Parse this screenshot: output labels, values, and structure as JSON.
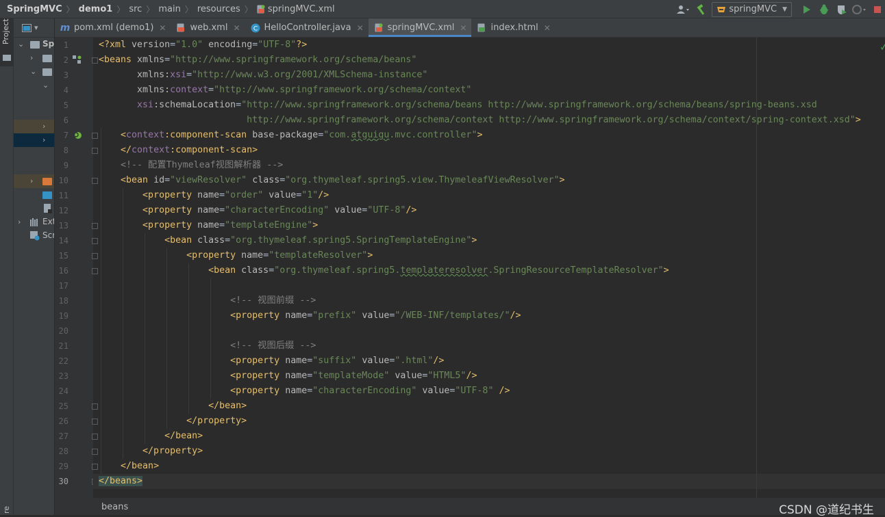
{
  "breadcrumb": {
    "items": [
      "SpringMVC",
      "demo1",
      "src",
      "main",
      "resources",
      "springMVC.xml"
    ]
  },
  "toolbar": {
    "run_config": "springMVC",
    "icons": [
      "user-icon",
      "hammer-icon",
      "run-icon",
      "debug-icon",
      "coverage-icon",
      "profile-icon",
      "stop-icon"
    ]
  },
  "sidebar": {
    "stripe_label": "Project",
    "bottom_label": "re",
    "root_label": "Sp",
    "ext_label": "Ext",
    "scr_label": "Scr"
  },
  "tabs": [
    {
      "label": "pom.xml (demo1)",
      "icon": "maven-icon",
      "active": false
    },
    {
      "label": "web.xml",
      "icon": "xml-file-icon",
      "active": false
    },
    {
      "label": "HelloController.java",
      "icon": "java-class-icon",
      "active": false
    },
    {
      "label": "springMVC.xml",
      "icon": "spring-xml-icon",
      "active": true
    },
    {
      "label": "index.html",
      "icon": "html-file-icon",
      "active": false
    }
  ],
  "editor": {
    "current_line": 30,
    "line_numbers": [
      "1",
      "2",
      "3",
      "4",
      "5",
      "6",
      "7",
      "8",
      "9",
      "10",
      "11",
      "12",
      "13",
      "14",
      "15",
      "16",
      "17",
      "18",
      "19",
      "20",
      "21",
      "22",
      "23",
      "24",
      "25",
      "26",
      "27",
      "28",
      "29",
      "30"
    ],
    "lines": [
      {
        "indent": "",
        "parts": [
          [
            "t",
            "<?xml "
          ],
          [
            "a",
            "version"
          ],
          [
            "p",
            "="
          ],
          [
            "v",
            "\"1.0\" "
          ],
          [
            "a",
            "encoding"
          ],
          [
            "p",
            "="
          ],
          [
            "v",
            "\"UTF-8\""
          ],
          [
            "t",
            "?>"
          ]
        ]
      },
      {
        "indent": "",
        "parts": [
          [
            "t",
            "<beans "
          ],
          [
            "a",
            "xmlns"
          ],
          [
            "p",
            "="
          ],
          [
            "v",
            "\"http://www.springframework.org/schema/beans\""
          ]
        ]
      },
      {
        "indent": "       ",
        "parts": [
          [
            "a",
            "xmlns:"
          ],
          [
            "ns",
            "xsi"
          ],
          [
            "p",
            "="
          ],
          [
            "v",
            "\"http://www.w3.org/2001/XMLSchema-instance\""
          ]
        ]
      },
      {
        "indent": "       ",
        "parts": [
          [
            "a",
            "xmlns:"
          ],
          [
            "ns",
            "context"
          ],
          [
            "p",
            "="
          ],
          [
            "v",
            "\"http://www.springframework.org/schema/context\""
          ]
        ]
      },
      {
        "indent": "       ",
        "parts": [
          [
            "ns",
            "xsi"
          ],
          [
            "a",
            ":schemaLocation"
          ],
          [
            "p",
            "="
          ],
          [
            "v",
            "\"http://www.springframework.org/schema/beans http://www.springframework.org/schema/beans/spring-beans.xsd"
          ]
        ]
      },
      {
        "indent": "                           ",
        "parts": [
          [
            "v",
            "http://www.springframework.org/schema/context http://www.springframework.org/schema/context/spring-context.xsd\""
          ],
          [
            "t",
            ">"
          ]
        ]
      },
      {
        "indent": "    ",
        "parts": [
          [
            "t",
            "<"
          ],
          [
            "ns",
            "context"
          ],
          [
            "t",
            ":component-scan "
          ],
          [
            "a",
            "base-package"
          ],
          [
            "p",
            "="
          ],
          [
            "v",
            "\"com."
          ],
          [
            "vs",
            "atguigu"
          ],
          [
            "v",
            ".mvc.controller\""
          ],
          [
            "t",
            ">"
          ]
        ]
      },
      {
        "indent": "    ",
        "parts": [
          [
            "t",
            "</"
          ],
          [
            "ns",
            "context"
          ],
          [
            "t",
            ":component-scan>"
          ]
        ]
      },
      {
        "indent": "    ",
        "parts": [
          [
            "c",
            "<!-- 配置Thymeleaf视图解析器 -->"
          ]
        ]
      },
      {
        "indent": "    ",
        "parts": [
          [
            "t",
            "<bean "
          ],
          [
            "a",
            "id"
          ],
          [
            "p",
            "="
          ],
          [
            "v",
            "\"viewResolver\" "
          ],
          [
            "a",
            "class"
          ],
          [
            "p",
            "="
          ],
          [
            "v",
            "\"org.thymeleaf.spring5.view.ThymeleafViewResolver\""
          ],
          [
            "t",
            ">"
          ]
        ]
      },
      {
        "indent": "        ",
        "parts": [
          [
            "t",
            "<property "
          ],
          [
            "a",
            "name"
          ],
          [
            "p",
            "="
          ],
          [
            "v",
            "\"order\" "
          ],
          [
            "a",
            "value"
          ],
          [
            "p",
            "="
          ],
          [
            "v",
            "\"1\""
          ],
          [
            "t",
            "/>"
          ]
        ]
      },
      {
        "indent": "        ",
        "parts": [
          [
            "t",
            "<property "
          ],
          [
            "a",
            "name"
          ],
          [
            "p",
            "="
          ],
          [
            "v",
            "\"characterEncoding\" "
          ],
          [
            "a",
            "value"
          ],
          [
            "p",
            "="
          ],
          [
            "v",
            "\"UTF-8\""
          ],
          [
            "t",
            "/>"
          ]
        ]
      },
      {
        "indent": "        ",
        "parts": [
          [
            "t",
            "<property "
          ],
          [
            "a",
            "name"
          ],
          [
            "p",
            "="
          ],
          [
            "v",
            "\"templateEngine\""
          ],
          [
            "t",
            ">"
          ]
        ]
      },
      {
        "indent": "            ",
        "parts": [
          [
            "t",
            "<bean "
          ],
          [
            "a",
            "class"
          ],
          [
            "p",
            "="
          ],
          [
            "v",
            "\"org.thymeleaf.spring5.SpringTemplateEngine\""
          ],
          [
            "t",
            ">"
          ]
        ]
      },
      {
        "indent": "                ",
        "parts": [
          [
            "t",
            "<property "
          ],
          [
            "a",
            "name"
          ],
          [
            "p",
            "="
          ],
          [
            "v",
            "\"templateResolver\""
          ],
          [
            "t",
            ">"
          ]
        ]
      },
      {
        "indent": "                    ",
        "parts": [
          [
            "t",
            "<bean "
          ],
          [
            "a",
            "class"
          ],
          [
            "p",
            "="
          ],
          [
            "v",
            "\"org.thymeleaf.spring5."
          ],
          [
            "vs",
            "templateresolver"
          ],
          [
            "v",
            ".SpringResourceTemplateResolver\""
          ],
          [
            "t",
            ">"
          ]
        ]
      },
      {
        "indent": "",
        "parts": []
      },
      {
        "indent": "                        ",
        "parts": [
          [
            "c",
            "<!-- 视图前缀 -->"
          ]
        ]
      },
      {
        "indent": "                        ",
        "parts": [
          [
            "t",
            "<property "
          ],
          [
            "a",
            "name"
          ],
          [
            "p",
            "="
          ],
          [
            "v",
            "\"prefix\" "
          ],
          [
            "a",
            "value"
          ],
          [
            "p",
            "="
          ],
          [
            "v",
            "\"/WEB-INF/templates/\""
          ],
          [
            "t",
            "/>"
          ]
        ]
      },
      {
        "indent": "",
        "parts": []
      },
      {
        "indent": "                        ",
        "parts": [
          [
            "c",
            "<!-- 视图后缀 -->"
          ]
        ]
      },
      {
        "indent": "                        ",
        "parts": [
          [
            "t",
            "<property "
          ],
          [
            "a",
            "name"
          ],
          [
            "p",
            "="
          ],
          [
            "v",
            "\"suffix\" "
          ],
          [
            "a",
            "value"
          ],
          [
            "p",
            "="
          ],
          [
            "v",
            "\".html\""
          ],
          [
            "t",
            "/>"
          ]
        ]
      },
      {
        "indent": "                        ",
        "parts": [
          [
            "t",
            "<property "
          ],
          [
            "a",
            "name"
          ],
          [
            "p",
            "="
          ],
          [
            "v",
            "\"templateMode\" "
          ],
          [
            "a",
            "value"
          ],
          [
            "p",
            "="
          ],
          [
            "v",
            "\"HTML5\""
          ],
          [
            "t",
            "/>"
          ]
        ]
      },
      {
        "indent": "                        ",
        "parts": [
          [
            "t",
            "<property "
          ],
          [
            "a",
            "name"
          ],
          [
            "p",
            "="
          ],
          [
            "v",
            "\"characterEncoding\" "
          ],
          [
            "a",
            "value"
          ],
          [
            "p",
            "="
          ],
          [
            "v",
            "\"UTF-8\" "
          ],
          [
            "t",
            "/>"
          ]
        ]
      },
      {
        "indent": "                    ",
        "parts": [
          [
            "t",
            "</bean>"
          ]
        ]
      },
      {
        "indent": "                ",
        "parts": [
          [
            "t",
            "</property>"
          ]
        ]
      },
      {
        "indent": "            ",
        "parts": [
          [
            "t",
            "</bean>"
          ]
        ]
      },
      {
        "indent": "        ",
        "parts": [
          [
            "t",
            "</property>"
          ]
        ]
      },
      {
        "indent": "    ",
        "parts": [
          [
            "t",
            "</bean>"
          ]
        ]
      },
      {
        "indent": "",
        "parts": [
          [
            "th",
            "</beans>"
          ]
        ]
      }
    ]
  },
  "status": {
    "breadcrumb": "beans",
    "watermark": "CSDN @道纪书生"
  },
  "colors": {
    "tag": "#e8bf6a",
    "attribute": "#bababa",
    "namespace": "#9876aa",
    "string": "#6a8759",
    "comment": "#808080",
    "active_tab_underline": "#4a88c7"
  }
}
